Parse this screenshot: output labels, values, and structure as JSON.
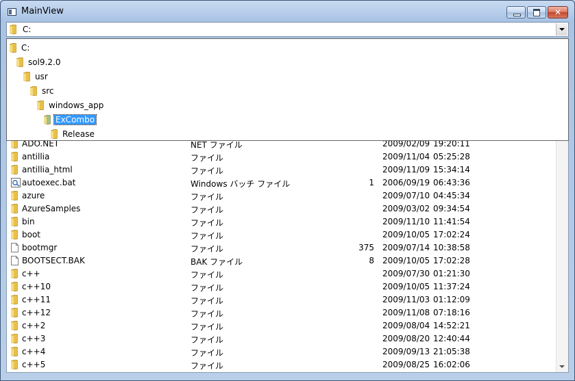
{
  "window": {
    "title": "MainView"
  },
  "combo": {
    "value": "C:"
  },
  "dropdown": {
    "items": [
      {
        "label": "C:",
        "level": 0,
        "selected": false
      },
      {
        "label": "sol9.2.0",
        "level": 1,
        "selected": false
      },
      {
        "label": "usr",
        "level": 2,
        "selected": false
      },
      {
        "label": "src",
        "level": 3,
        "selected": false
      },
      {
        "label": "windows_app",
        "level": 4,
        "selected": false
      },
      {
        "label": "ExCombo",
        "level": 5,
        "selected": true
      },
      {
        "label": "Release",
        "level": 6,
        "selected": false
      }
    ]
  },
  "files": [
    {
      "name": "ADO.NET",
      "type": "NET ファイル",
      "size": "",
      "date": "2009/02/09",
      "time": "19:20:11",
      "icon": "folder-icon"
    },
    {
      "name": "antillia",
      "type": "ファイル",
      "size": "",
      "date": "2009/11/04",
      "time": "05:25:28",
      "icon": "folder-icon"
    },
    {
      "name": "antillia_html",
      "type": "ファイル",
      "size": "",
      "date": "2009/11/09",
      "time": "15:34:14",
      "icon": "folder-icon"
    },
    {
      "name": "autoexec.bat",
      "type": "Windows バッチ ファイル",
      "size": "1",
      "date": "2006/09/19",
      "time": "06:43:36",
      "icon": "batch-file-icon"
    },
    {
      "name": "azure",
      "type": "ファイル",
      "size": "",
      "date": "2009/07/10",
      "time": "04:45:34",
      "icon": "folder-icon"
    },
    {
      "name": "AzureSamples",
      "type": "ファイル",
      "size": "",
      "date": "2009/03/02",
      "time": "09:34:54",
      "icon": "folder-icon"
    },
    {
      "name": "bin",
      "type": "ファイル",
      "size": "",
      "date": "2009/11/10",
      "time": "11:41:54",
      "icon": "folder-icon"
    },
    {
      "name": "boot",
      "type": "ファイル",
      "size": "",
      "date": "2009/10/05",
      "time": "17:02:24",
      "icon": "folder-icon"
    },
    {
      "name": "bootmgr",
      "type": "ファイル",
      "size": "375",
      "date": "2009/07/14",
      "time": "10:38:58",
      "icon": "file-icon"
    },
    {
      "name": "BOOTSECT.BAK",
      "type": "BAK ファイル",
      "size": "8",
      "date": "2009/10/05",
      "time": "17:02:28",
      "icon": "file-icon"
    },
    {
      "name": "c++",
      "type": "ファイル",
      "size": "",
      "date": "2009/07/30",
      "time": "01:21:30",
      "icon": "folder-icon"
    },
    {
      "name": "c++10",
      "type": "ファイル",
      "size": "",
      "date": "2009/10/05",
      "time": "11:37:24",
      "icon": "folder-icon"
    },
    {
      "name": "c++11",
      "type": "ファイル",
      "size": "",
      "date": "2009/11/03",
      "time": "01:12:09",
      "icon": "folder-icon"
    },
    {
      "name": "c++12",
      "type": "ファイル",
      "size": "",
      "date": "2009/11/08",
      "time": "07:18:16",
      "icon": "folder-icon"
    },
    {
      "name": "c++2",
      "type": "ファイル",
      "size": "",
      "date": "2009/08/04",
      "time": "14:52:21",
      "icon": "folder-icon"
    },
    {
      "name": "c++3",
      "type": "ファイル",
      "size": "",
      "date": "2009/08/20",
      "time": "12:40:44",
      "icon": "folder-icon"
    },
    {
      "name": "c++4",
      "type": "ファイル",
      "size": "",
      "date": "2009/09/13",
      "time": "21:05:38",
      "icon": "folder-icon"
    },
    {
      "name": "c++5",
      "type": "ファイル",
      "size": "",
      "date": "2009/08/25",
      "time": "16:02:06",
      "icon": "folder-icon"
    }
  ],
  "colors": {
    "selection": "#3399ff",
    "folder": "#e8c04a"
  }
}
